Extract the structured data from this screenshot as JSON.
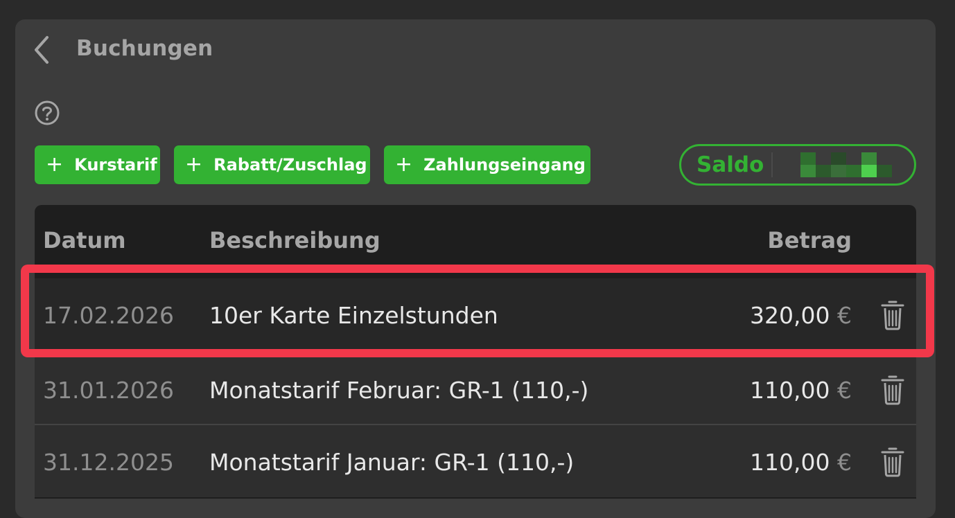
{
  "header": {
    "back_icon": "chevron-left-icon",
    "title": "Buchungen",
    "help_icon": "question-circle-icon"
  },
  "actions": [
    {
      "label": "Kurstarif",
      "icon": "plus-icon"
    },
    {
      "label": "Rabatt/Zuschlag",
      "icon": "plus-icon"
    },
    {
      "label": "Zahlungseingang",
      "icon": "plus-icon"
    }
  ],
  "saldo": {
    "label": "Saldo",
    "value_state": "pixelated"
  },
  "table": {
    "columns": {
      "date": "Datum",
      "description": "Beschreibung",
      "amount": "Betrag"
    },
    "rows": [
      {
        "date": "17.02.2026",
        "description": "10er Karte Einzelstunden",
        "amount": "320,00",
        "currency": "€",
        "highlighted": true
      },
      {
        "date": "31.01.2026",
        "description": "Monatstarif Februar: GR-1 (110,-)",
        "amount": "110,00",
        "currency": "€"
      },
      {
        "date": "31.12.2025",
        "description": "Monatstarif Januar: GR-1 (110,-)",
        "amount": "110,00",
        "currency": "€"
      }
    ]
  },
  "colors": {
    "accent_green": "#33b233",
    "highlight_red": "#f2384a",
    "panel_bg": "#3c3c3c",
    "table_bg": "#1e1e1e"
  }
}
